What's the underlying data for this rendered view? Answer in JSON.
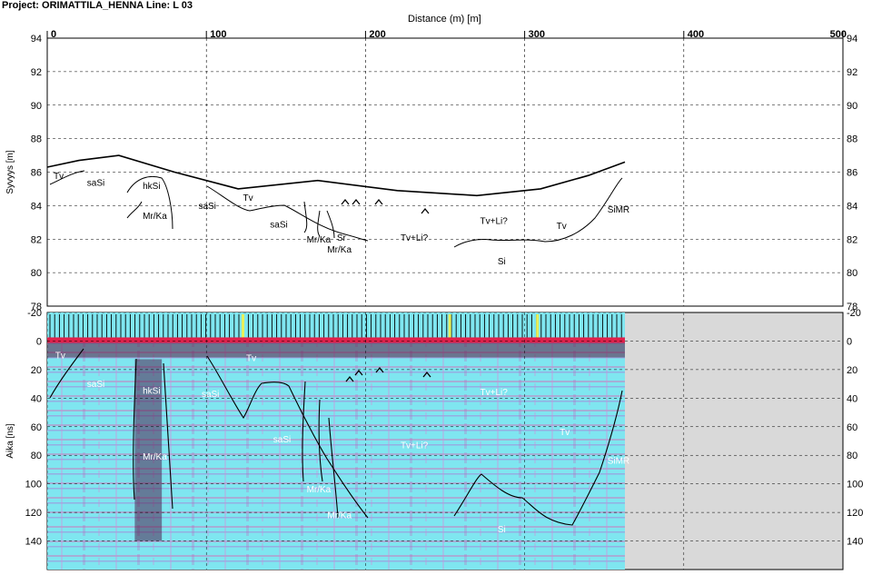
{
  "header": {
    "title": "Project: ORIMATTILA_HENNA  Line: L 03",
    "x_axis_label": "Distance (m) [m]"
  },
  "chart_data": [
    {
      "type": "line",
      "panel": "elevation",
      "ylabel": "Syvyys [m]",
      "xlim": [
        0,
        500
      ],
      "ylim": [
        78,
        94
      ],
      "x_ticks": [
        0,
        100,
        200,
        300,
        400,
        500
      ],
      "y_ticks": [
        78,
        80,
        82,
        84,
        86,
        88,
        90,
        92,
        94
      ],
      "grid": true,
      "series": [
        {
          "x": [
            0,
            20,
            45,
            80,
            120,
            170,
            220,
            270,
            310,
            340,
            363
          ],
          "y": [
            86.3,
            86.7,
            87.0,
            86.0,
            85.0,
            85.5,
            84.9,
            84.6,
            85.0,
            85.8,
            86.6
          ]
        }
      ],
      "annotations": [
        {
          "text": "Tv",
          "x": 4,
          "y": 85.6
        },
        {
          "text": "saSi",
          "x": 25,
          "y": 85.2
        },
        {
          "text": "hkSi",
          "x": 60,
          "y": 85.0
        },
        {
          "text": "Mr/Ka",
          "x": 60,
          "y": 83.2
        },
        {
          "text": "saSi",
          "x": 95,
          "y": 83.8
        },
        {
          "text": "Tv",
          "x": 123,
          "y": 84.3
        },
        {
          "text": "saSi",
          "x": 140,
          "y": 82.7
        },
        {
          "text": "Mr/Ka",
          "x": 163,
          "y": 81.8
        },
        {
          "text": "Sr",
          "x": 182,
          "y": 81.9
        },
        {
          "text": "Mr/Ka",
          "x": 176,
          "y": 81.2
        },
        {
          "text": "Tv+Li?",
          "x": 222,
          "y": 81.9
        },
        {
          "text": "Tv+Li?",
          "x": 272,
          "y": 82.9
        },
        {
          "text": "Tv",
          "x": 320,
          "y": 82.6
        },
        {
          "text": "SiMR",
          "x": 352,
          "y": 83.6
        },
        {
          "text": "Si",
          "x": 283,
          "y": 80.5
        }
      ]
    },
    {
      "type": "heatmap",
      "panel": "radargram",
      "ylabel": "Aika [ns]",
      "xlim": [
        0,
        500
      ],
      "ylim": [
        160,
        -20
      ],
      "y_ticks": [
        -20,
        0,
        20,
        40,
        60,
        80,
        100,
        120,
        140
      ],
      "data_extent_x": [
        0,
        363
      ],
      "annotations": [
        {
          "text": "Tv",
          "x": 5,
          "y": 12
        },
        {
          "text": "saSi",
          "x": 25,
          "y": 32
        },
        {
          "text": "hkSi",
          "x": 60,
          "y": 37
        },
        {
          "text": "Mr/Ka",
          "x": 60,
          "y": 83
        },
        {
          "text": "saSi",
          "x": 97,
          "y": 39
        },
        {
          "text": "Tv",
          "x": 125,
          "y": 14
        },
        {
          "text": "saSi",
          "x": 142,
          "y": 71
        },
        {
          "text": "Mr/Ka",
          "x": 163,
          "y": 106
        },
        {
          "text": "Mr/Ka",
          "x": 176,
          "y": 124
        },
        {
          "text": "Tv+Li?",
          "x": 222,
          "y": 75
        },
        {
          "text": "Tv+Li?",
          "x": 272,
          "y": 38
        },
        {
          "text": "Tv",
          "x": 322,
          "y": 66
        },
        {
          "text": "SiMR",
          "x": 352,
          "y": 86
        },
        {
          "text": "Si",
          "x": 283,
          "y": 134
        }
      ]
    }
  ]
}
